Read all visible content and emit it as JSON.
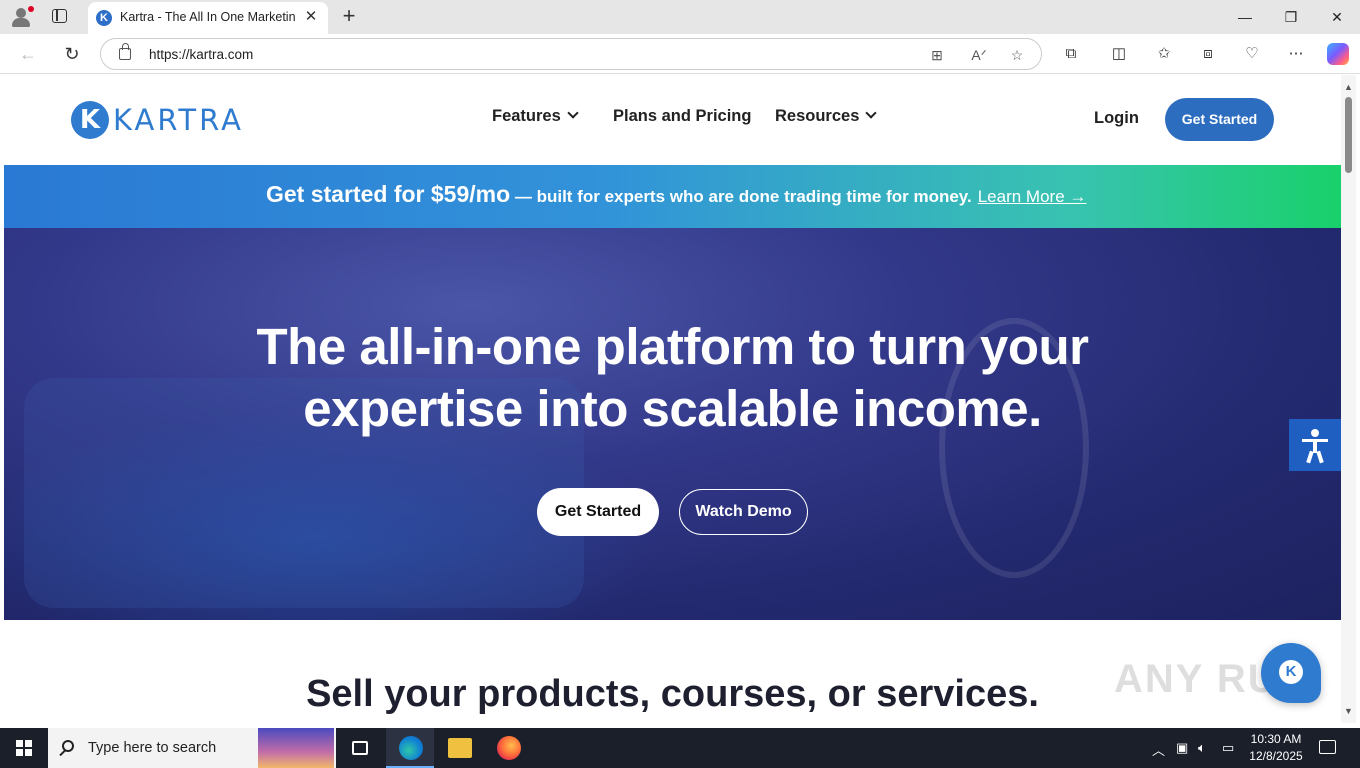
{
  "browser": {
    "tab_title": "Kartra - The All In One Marketing",
    "tab_favicon_letter": "K",
    "url": "https://kartra.com",
    "window_controls": {
      "minimize": "—",
      "restore": "❐",
      "close": "✕"
    }
  },
  "site": {
    "logo_letter": "K",
    "logo_text": "KARTRA",
    "nav": [
      {
        "label": "Features",
        "has_dropdown": true
      },
      {
        "label": "Plans and Pricing",
        "has_dropdown": false
      },
      {
        "label": "Resources",
        "has_dropdown": true
      }
    ],
    "login_label": "Login",
    "header_cta_label": "Get Started"
  },
  "promo": {
    "big_text": "Get started for $59/mo",
    "small_text": " — built for experts who are done trading time for money.",
    "link_text": "Learn More →"
  },
  "hero": {
    "title_line1": "The all-in-one platform to turn your",
    "title_line2": "expertise into scalable income.",
    "primary_button": "Get Started",
    "secondary_button": "Watch Demo"
  },
  "section": {
    "title": "Sell your products, courses, or services."
  },
  "chat_widget_letter": "K",
  "watermark": "ANY RUN",
  "taskbar": {
    "search_placeholder": "Type here to search",
    "time": "10:30 AM",
    "date": "12/8/2025"
  },
  "colors": {
    "brand_blue": "#2e7bcf",
    "cta_blue": "#2c6dbf",
    "hero_navy": "#23296e",
    "promo_green": "#19d16b"
  }
}
